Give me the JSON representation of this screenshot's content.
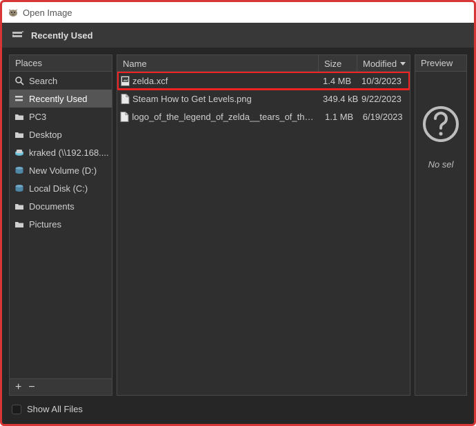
{
  "window": {
    "title": "Open Image"
  },
  "path_label": "Recently Used",
  "places": {
    "header": "Places",
    "items": [
      {
        "label": "Search",
        "icon": "search"
      },
      {
        "label": "Recently Used",
        "icon": "recent",
        "selected": true
      },
      {
        "label": "PC3",
        "icon": "folder"
      },
      {
        "label": "Desktop",
        "icon": "folder"
      },
      {
        "label": "kraked (\\\\192.168....",
        "icon": "network"
      },
      {
        "label": "New Volume (D:)",
        "icon": "drive"
      },
      {
        "label": "Local Disk (C:)",
        "icon": "drive"
      },
      {
        "label": "Documents",
        "icon": "folder"
      },
      {
        "label": "Pictures",
        "icon": "folder"
      }
    ],
    "footer": {
      "add": "+",
      "remove": "−"
    }
  },
  "files": {
    "columns": {
      "name": "Name",
      "size": "Size",
      "modified": "Modified"
    },
    "rows": [
      {
        "name": "zelda.xcf",
        "size": "1.4 MB",
        "modified": "10/3/2023",
        "icon": "image-xcf",
        "highlight": true
      },
      {
        "name": "Steam How to Get Levels.png",
        "size": "349.4 kB",
        "modified": "9/22/2023",
        "icon": "file"
      },
      {
        "name": "logo_of_the_legend_of_zelda__tears_of_the_...",
        "size": "1.1 MB",
        "modified": "6/19/2023",
        "icon": "file"
      }
    ]
  },
  "preview": {
    "header": "Preview",
    "no_selection": "No sel"
  },
  "show_all_files": {
    "label": "Show All Files",
    "checked": false
  }
}
